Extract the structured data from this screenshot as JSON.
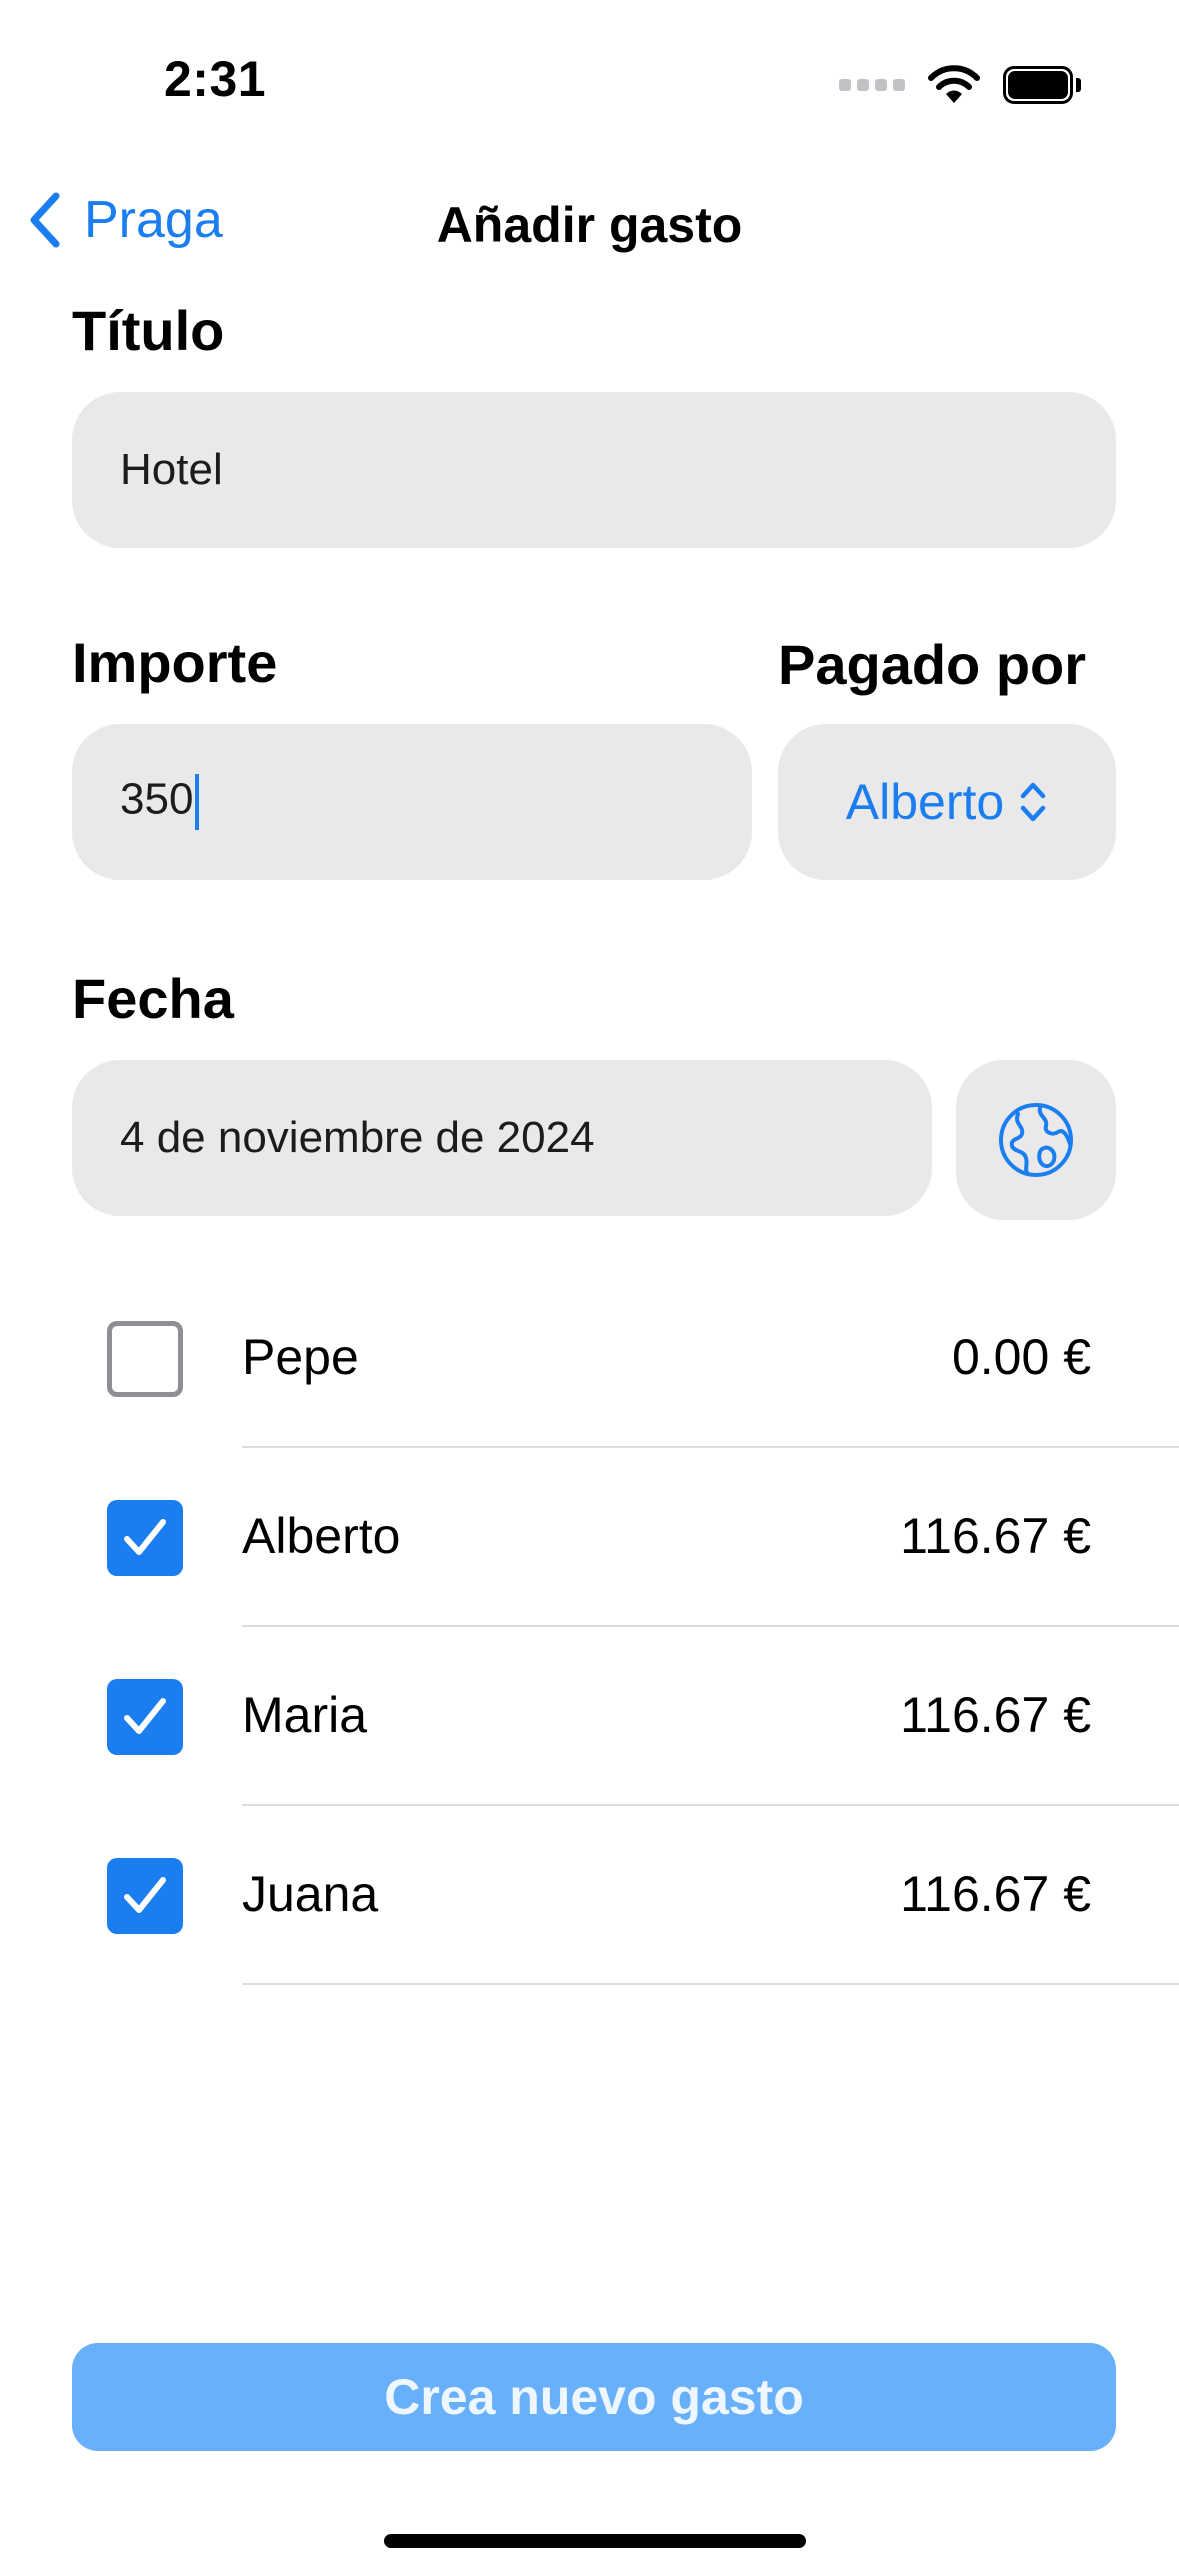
{
  "status_bar": {
    "time": "2:31"
  },
  "nav": {
    "back_label": "Praga",
    "title": "Añadir gasto"
  },
  "form": {
    "title_label": "Título",
    "title_value": "Hotel",
    "amount_label": "Importe",
    "amount_value": "350",
    "paid_by_label": "Pagado por",
    "paid_by_value": "Alberto",
    "date_label": "Fecha",
    "date_value": "4 de noviembre de 2024"
  },
  "participants": [
    {
      "name": "Pepe",
      "amount": "0.00 €",
      "checked": false
    },
    {
      "name": "Alberto",
      "amount": "116.67 €",
      "checked": true
    },
    {
      "name": "Maria",
      "amount": "116.67 €",
      "checked": true
    },
    {
      "name": "Juana",
      "amount": "116.67 €",
      "checked": true
    }
  ],
  "actions": {
    "create_label": "Crea nuevo gasto"
  },
  "colors": {
    "accent": "#1a7df0",
    "field_bg": "#e9e9ea",
    "button_disabled": "#68b0fa"
  },
  "icons": [
    "wifi-icon",
    "battery-icon",
    "chevron-left-icon",
    "chevron-up-down-icon",
    "globe-icon",
    "checkmark-icon"
  ]
}
